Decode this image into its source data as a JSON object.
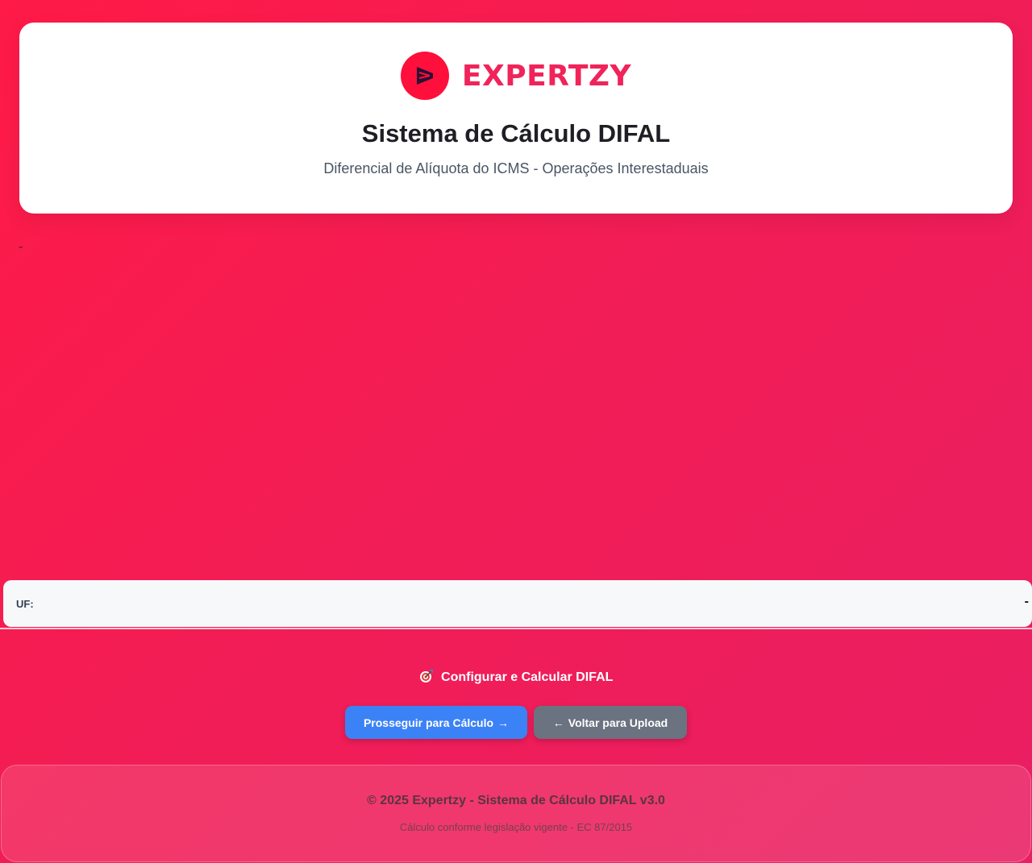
{
  "brand": {
    "name": "EXPERTZY",
    "color": "#f0245a",
    "logo_icon": "play-bars-icon"
  },
  "header": {
    "title": "Sistema de Cálculo DIFAL",
    "subtitle": "Diferencial de Alíquota do ICMS - Operações Interestaduais"
  },
  "main": {
    "placeholder_value": "-"
  },
  "uf_panel": {
    "label": "UF:",
    "value": "-"
  },
  "config": {
    "icon": "target-icon",
    "heading": "Configurar e Calcular DIFAL"
  },
  "buttons": {
    "proceed": {
      "label": "Prosseguir para Cálculo",
      "arrow": "→",
      "color": "#3b82f6"
    },
    "back": {
      "label": "Voltar para Upload",
      "arrow": "←",
      "color": "#6b7280"
    }
  },
  "footer": {
    "main": "© 2025 Expertzy - Sistema de Cálculo DIFAL v3.0",
    "sub": "Cálculo conforme legislação vigente - EC 87/2015"
  },
  "theme": {
    "background_start": "#ff1a47",
    "background_end": "#e91e63"
  }
}
